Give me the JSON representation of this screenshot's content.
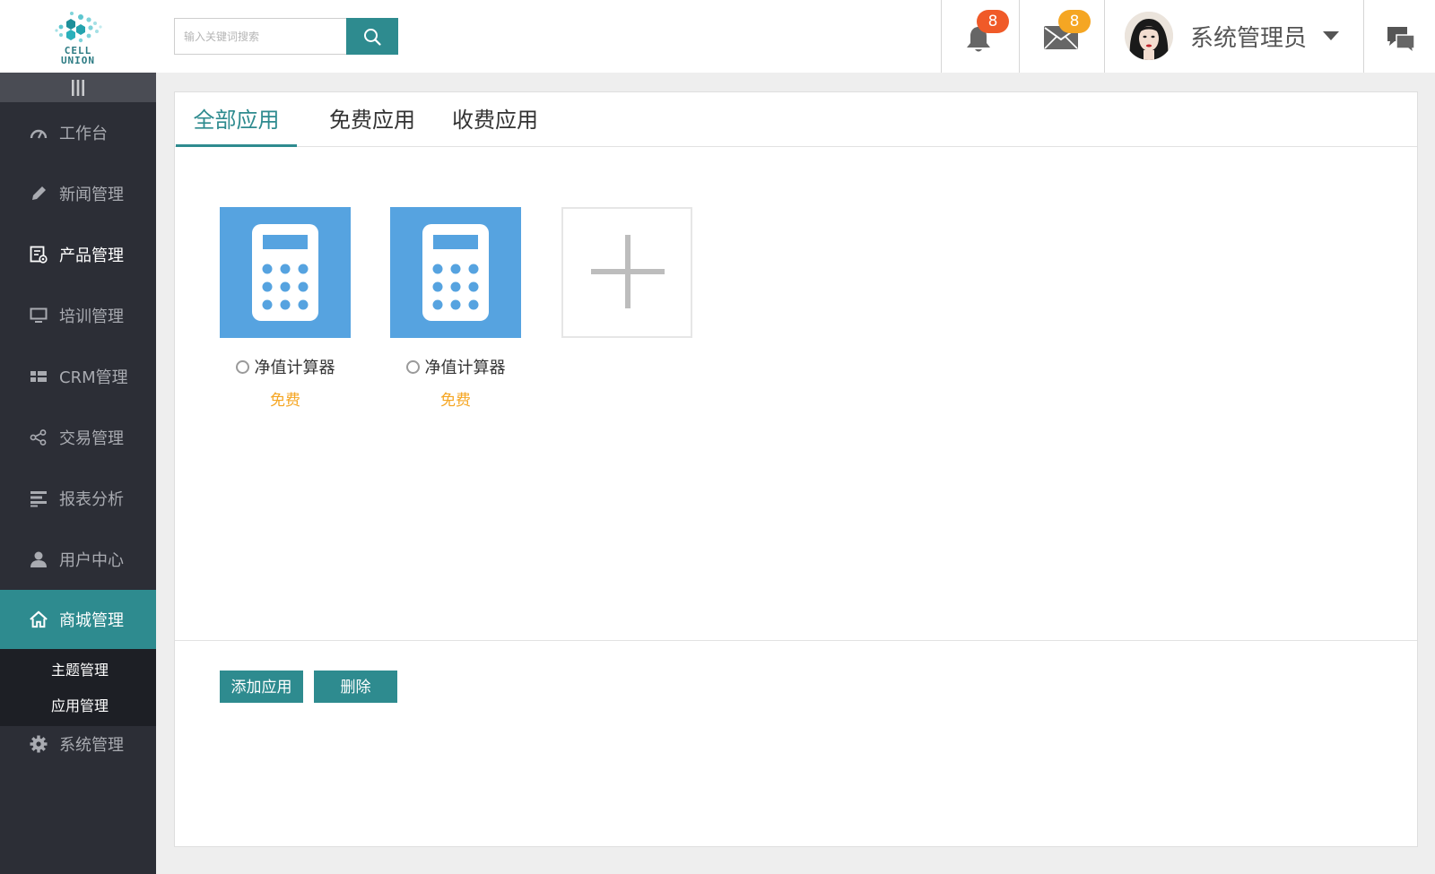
{
  "brand": {
    "logo_text_line1": "CELL",
    "logo_text_line2": "UNION",
    "logo_color": "#2c7b83"
  },
  "search": {
    "placeholder": "输入关键词搜索",
    "button_icon": "search-icon"
  },
  "header": {
    "notifications_count": "8",
    "notifications_badge_color": "#f05a28",
    "messages_count": "8",
    "messages_badge_color": "#f5a623",
    "user_name": "系统管理员",
    "chat_icon": "chat-icon"
  },
  "sidebar": {
    "items": [
      {
        "label": "工作台",
        "icon": "dashboard-icon"
      },
      {
        "label": "新闻管理",
        "icon": "pencil-icon"
      },
      {
        "label": "产品管理",
        "icon": "product-icon"
      },
      {
        "label": "培训管理",
        "icon": "monitor-icon"
      },
      {
        "label": "CRM管理",
        "icon": "grid-icon"
      },
      {
        "label": "交易管理",
        "icon": "share-icon"
      },
      {
        "label": "报表分析",
        "icon": "report-icon"
      },
      {
        "label": "用户中心",
        "icon": "user-icon"
      },
      {
        "label": "商城管理",
        "icon": "home-icon"
      },
      {
        "label": "系统管理",
        "icon": "gear-icon"
      }
    ],
    "sub_items": [
      {
        "label": "主题管理"
      },
      {
        "label": "应用管理"
      }
    ],
    "active_color": "#2e8b8f"
  },
  "tabs": [
    {
      "label": "全部应用"
    },
    {
      "label": "免费应用"
    },
    {
      "label": "收费应用"
    }
  ],
  "apps": [
    {
      "name": "净值计算器",
      "price": "免费",
      "icon": "calculator-icon"
    },
    {
      "name": "净值计算器",
      "price": "免费",
      "icon": "calculator-icon"
    }
  ],
  "actions": {
    "add_label": "添加应用",
    "delete_label": "删除"
  },
  "colors": {
    "accent": "#2e8b8f",
    "app_tile": "#56a3e0",
    "price": "#f5a623",
    "sidebar_bg": "#2c2e36"
  }
}
